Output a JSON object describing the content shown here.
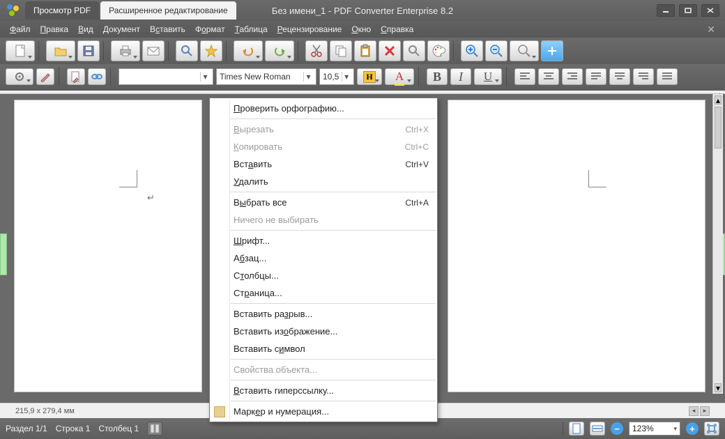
{
  "titlebar": {
    "tab_view": "Просмотр PDF",
    "tab_edit": "Расширенное редактирование",
    "document_title": "Без имени_1 - PDF Converter Enterprise 8.2"
  },
  "menubar": {
    "file": "Файл",
    "edit": "Правка",
    "view": "Вид",
    "document": "Документ",
    "insert": "Вставить",
    "format": "Формат",
    "table": "Таблица",
    "review": "Рецензирование",
    "window": "Окно",
    "help": "Справка"
  },
  "toolbar2": {
    "style_value": "",
    "font_value": "Times New Roman",
    "size_value": "10,5"
  },
  "context_menu": {
    "spellcheck": "Проверить орфографию...",
    "cut": "Вырезать",
    "cut_sc": "Ctrl+X",
    "copy": "Копировать",
    "copy_sc": "Ctrl+C",
    "paste": "Вставить",
    "paste_sc": "Ctrl+V",
    "delete": "Удалить",
    "select_all": "Выбрать все",
    "select_all_sc": "Ctrl+A",
    "deselect": "Ничего не выбирать",
    "font": "Шрифт...",
    "paragraph": "Абзац...",
    "columns": "Столбцы...",
    "page": "Страница...",
    "insert_break": "Вставить разрыв...",
    "insert_image": "Вставить изображение...",
    "insert_symbol": "Вставить символ",
    "object_props": "Свойства объекта...",
    "insert_link": "Вставить гиперссылку...",
    "bullets": "Маркер и нумерация..."
  },
  "page": {
    "dimensions": "215,9 x 279,4 мм"
  },
  "statusbar": {
    "section": "Раздел 1/1",
    "line": "Строка 1",
    "column": "Столбец 1",
    "zoom": "123%"
  }
}
